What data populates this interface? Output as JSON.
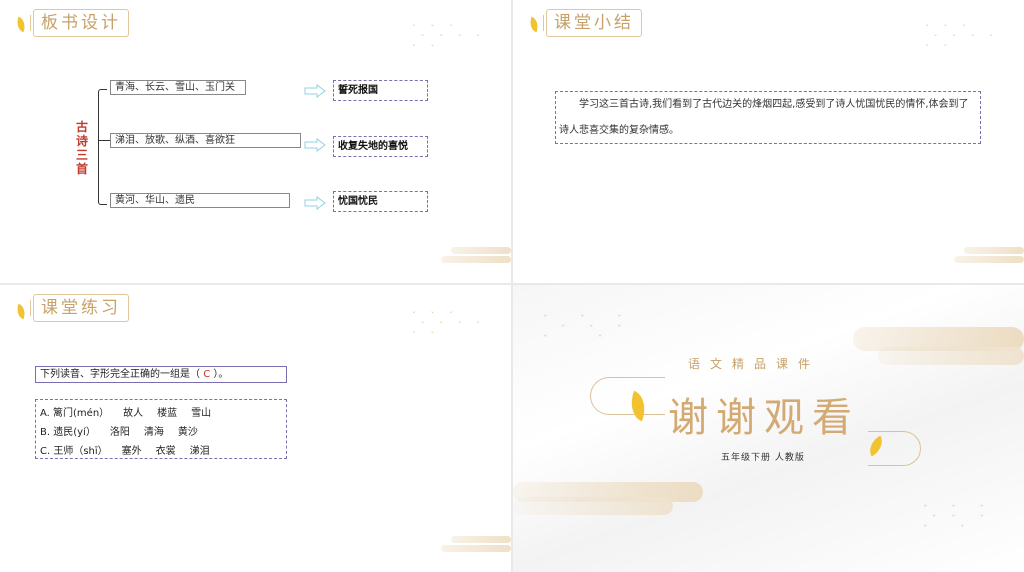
{
  "slide1": {
    "title": "板书设计",
    "vertical_label": [
      "古",
      "诗",
      "三",
      "首"
    ],
    "rows": [
      {
        "text": "青海、长云、雪山、玉门关",
        "answer": "誓死报国"
      },
      {
        "text": "涕泪、放歌、纵酒、喜欲狂",
        "answer": "收复失地的喜悦"
      },
      {
        "text": "黄河、华山、遗民",
        "answer": "忧国忧民"
      }
    ]
  },
  "slide2": {
    "title": "课堂小结",
    "summary": "学习这三首古诗,我们看到了古代边关的烽烟四起,感受到了诗人忧国忧民的情怀,体会到了诗人悲喜交集的复杂情感。"
  },
  "slide3": {
    "title": "课堂练习",
    "question_prefix": "下列读音、字形完全正确的一组是（",
    "question_answer": "C",
    "question_suffix": "）。",
    "options": [
      [
        "A. 篱门(mén）",
        "故人",
        "楼蓝",
        "雪山"
      ],
      [
        "B. 遗民(yí）",
        "洛阳",
        "清海",
        "黄沙"
      ],
      [
        "C. 王师（shī）",
        "塞外",
        "衣裳",
        "涕泪"
      ]
    ]
  },
  "slide4": {
    "top_text": "语文精品课件",
    "main_text": "谢谢观看",
    "sub_text": "五年级下册 人教版"
  },
  "colors": {
    "gold": "#c7a168",
    "leaf": "#f2c230",
    "dashed_border": "#7a6fb0",
    "accent_red": "#c0392b"
  }
}
